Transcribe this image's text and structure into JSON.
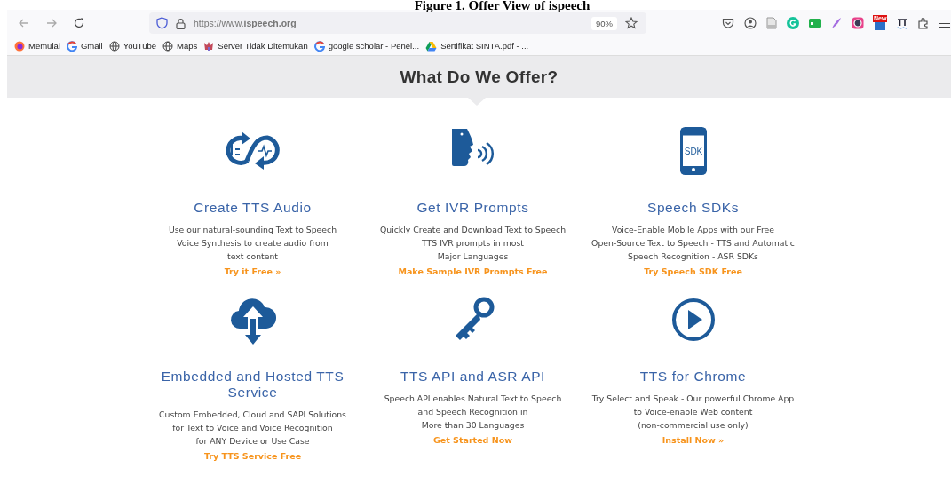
{
  "caption": "Figure 1. Offer View of ispeech",
  "browser": {
    "url": "https://www.**ispeech.org**",
    "zoom": "90%",
    "extensions": [
      {
        "kind": "pocket"
      },
      {
        "kind": "account"
      },
      {
        "kind": "reader"
      },
      {
        "kind": "grammar"
      },
      {
        "kind": "green-tile"
      },
      {
        "kind": "feather"
      },
      {
        "kind": "ring"
      },
      {
        "kind": "news",
        "badge": "New"
      },
      {
        "kind": "tool"
      },
      {
        "kind": "puzzle"
      },
      {
        "kind": "menu"
      }
    ],
    "bookmarks": [
      {
        "kind": "firefox",
        "label": "Memulai"
      },
      {
        "kind": "google",
        "label": "Gmail"
      },
      {
        "kind": "globe",
        "label": "YouTube"
      },
      {
        "kind": "globe",
        "label": "Maps"
      },
      {
        "kind": "error",
        "label": "Server Tidak Ditemukan"
      },
      {
        "kind": "google",
        "label": "google scholar - Penel..."
      },
      {
        "kind": "drive",
        "label": "Sertifikat SINTA.pdf - ..."
      }
    ]
  },
  "page": {
    "heading": "What Do We Offer?",
    "offers": [
      {
        "kind": "abc-cycle",
        "title": "Create TTS Audio",
        "description": [
          "Use our natural-sounding Text to Speech",
          "Voice Synthesis to create audio from",
          "text content"
        ],
        "link": "Try it Free »"
      },
      {
        "kind": "speaking-head",
        "title": "Get IVR Prompts",
        "description": [
          "Quickly Create and Download Text to Speech",
          "TTS IVR prompts in most",
          "Major Languages"
        ],
        "link": "Make Sample IVR Prompts Free"
      },
      {
        "kind": "phone",
        "icon_text": "SDK",
        "title": "Speech SDKs",
        "description": [
          "Voice-Enable Mobile Apps with our Free",
          "Open-Source Text to Speech - TTS and Automatic",
          "Speech Recognition - ASR SDKs"
        ],
        "link": "Try Speech SDK Free"
      },
      {
        "kind": "cloud",
        "title": "Embedded and Hosted TTS Service",
        "description": [
          "Custom Embedded, Cloud and SAPI Solutions",
          "for Text to Voice and Voice Recognition",
          "for ANY Device or Use Case"
        ],
        "link": "Try TTS Service Free"
      },
      {
        "kind": "key",
        "title": "TTS API and ASR API",
        "description": [
          "Speech API enables Natural Text to Speech",
          "and Speech Recognition in",
          "More than 30 Languages"
        ],
        "link": "Get Started Now"
      },
      {
        "kind": "play",
        "title": "TTS for Chrome",
        "description": [
          "Try Select and Speak - Our powerful Chrome App",
          "to Voice-enable Web content",
          "(non-commercial use only)"
        ],
        "link": "Install Now »"
      }
    ]
  }
}
